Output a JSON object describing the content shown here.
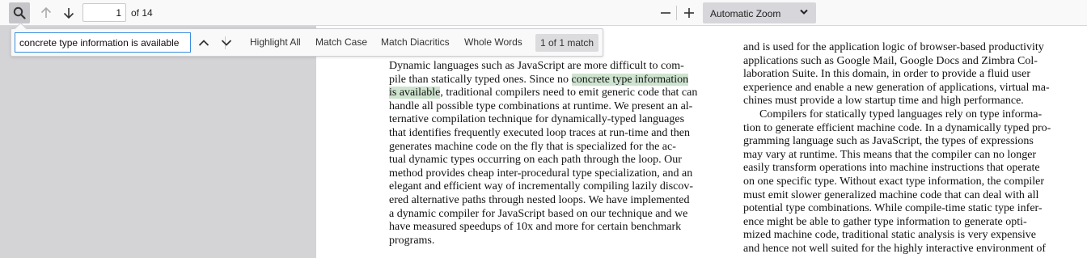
{
  "toolbar": {
    "search_icon": "search-icon",
    "prev_icon": "arrow-up-icon",
    "next_icon": "arrow-down-icon",
    "page_number": "1",
    "page_count": "of 14",
    "zoom_out_icon": "minus-icon",
    "zoom_in_icon": "plus-icon",
    "zoom_value": "Automatic Zoom"
  },
  "findbar": {
    "query": "concrete type information is available",
    "prev_icon": "chevron-up-icon",
    "next_icon": "chevron-down-icon",
    "highlight_all": "Highlight All",
    "match_case": "Match Case",
    "match_diacritics": "Match Diacritics",
    "whole_words": "Whole Words",
    "match_count": "1 of 1 match"
  },
  "document": {
    "left_column": [
      "Dynamic languages such as JavaScript are more difficult to com-",
      "pile than statically typed ones. Since no ",
      "concrete type information",
      "is available",
      ", traditional compilers need to emit generic code that can",
      "handle all possible type combinations at runtime. We present an al-",
      "ternative compilation technique for dynamically-typed languages",
      "that identifies frequently executed loop traces at run-time and then",
      "generates machine code on the fly that is specialized for the ac-",
      "tual dynamic types occurring on each path through the loop. Our",
      "method provides cheap inter-procedural type specialization, and an",
      "elegant and efficient way of incrementally compiling lazily discov-",
      "ered alternative paths through nested loops. We have implemented",
      "a dynamic compiler for JavaScript based on our technique and we",
      "have measured speedups of 10x and more for certain benchmark",
      "programs."
    ],
    "right_column": [
      "and is used for the application logic of browser-based productivity",
      "applications such as Google Mail, Google Docs and Zimbra Col-",
      "laboration Suite. In this domain, in order to provide a fluid user",
      "experience and enable a new generation of applications, virtual ma-",
      "chines must provide a low startup time and high performance.",
      "Compilers for statically typed languages rely on type informa-",
      "tion to generate efficient machine code. In a dynamically typed pro-",
      "gramming language such as JavaScript, the types of expressions",
      "may vary at runtime. This means that the compiler can no longer",
      "easily transform operations into machine instructions that operate",
      "on one specific type. Without exact type information, the compiler",
      "must emit slower generalized machine code that can deal with all",
      "potential type combinations. While compile-time static type infer-",
      "ence might be able to gather type information to generate opti-",
      "mized machine code, traditional static analysis is very expensive",
      "and hence not well suited for the highly interactive environment of"
    ]
  },
  "colors": {
    "toolbar_bg": "#f9f9fa",
    "highlight": "#cfe4d0",
    "focus_border": "#3b8ddf"
  }
}
